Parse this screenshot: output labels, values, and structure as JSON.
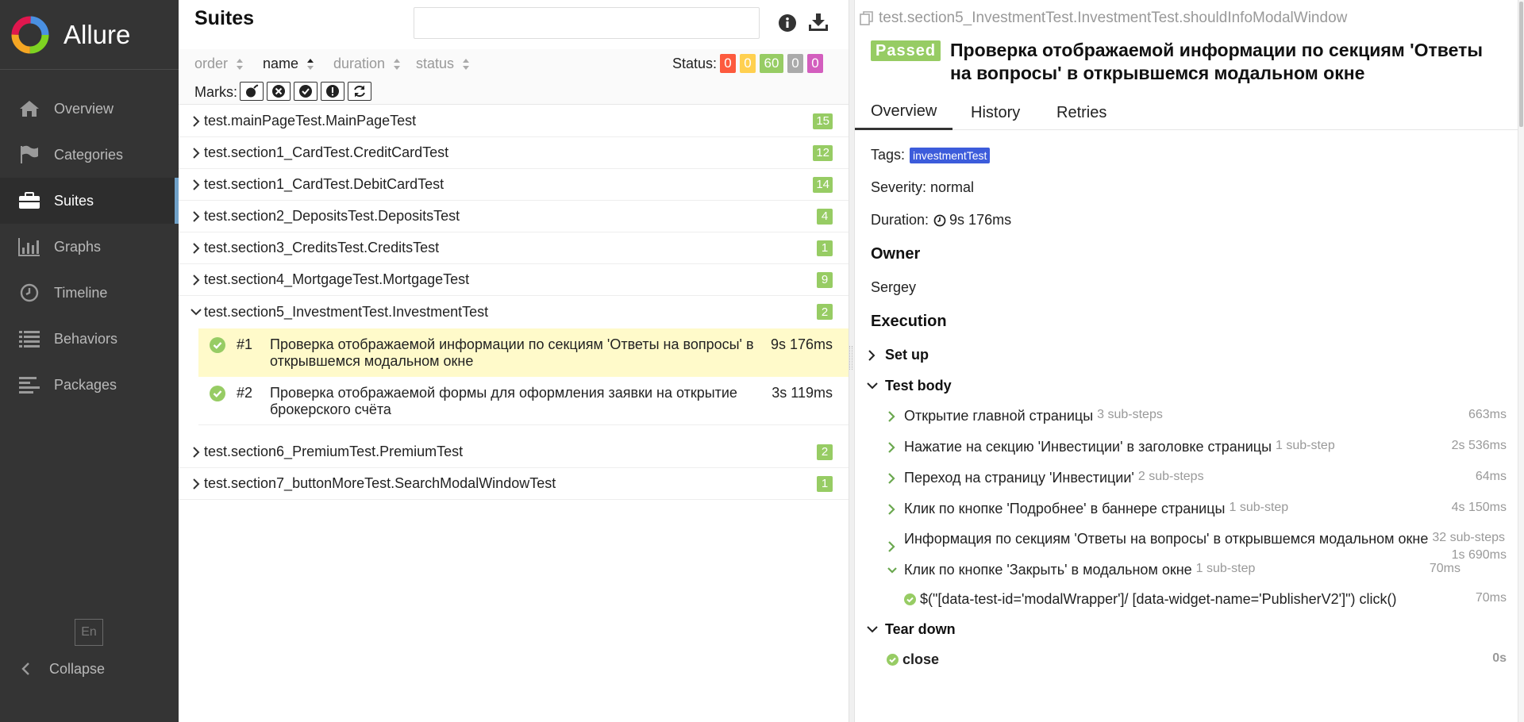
{
  "app": {
    "brand": "Allure"
  },
  "sidebar": {
    "items": [
      {
        "label": "Overview",
        "icon": "home-icon"
      },
      {
        "label": "Categories",
        "icon": "flag-icon"
      },
      {
        "label": "Suites",
        "icon": "briefcase-icon",
        "active": true
      },
      {
        "label": "Graphs",
        "icon": "bar-chart-icon"
      },
      {
        "label": "Timeline",
        "icon": "clock-icon"
      },
      {
        "label": "Behaviors",
        "icon": "list-icon"
      },
      {
        "label": "Packages",
        "icon": "align-left-icon"
      }
    ],
    "language": "En",
    "collapse": "Collapse"
  },
  "suites": {
    "title": "Suites",
    "search_placeholder": "",
    "sort": {
      "order": "order",
      "name": "name",
      "duration": "duration",
      "status": "status"
    },
    "status_label": "Status:",
    "counts": [
      {
        "value": "0",
        "color": "#fd5a3e"
      },
      {
        "value": "0",
        "color": "#ffd050"
      },
      {
        "value": "60",
        "color": "#97cc64"
      },
      {
        "value": "0",
        "color": "#aaaaaa"
      },
      {
        "value": "0",
        "color": "#d35ebe"
      }
    ],
    "marks_label": "Marks:",
    "rows": [
      {
        "name": "test.mainPageTest.MainPageTest",
        "count": "15"
      },
      {
        "name": "test.section1_CardTest.CreditCardTest",
        "count": "12"
      },
      {
        "name": "test.section1_CardTest.DebitCardTest",
        "count": "14"
      },
      {
        "name": "test.section2_DepositsTest.DepositsTest",
        "count": "4"
      },
      {
        "name": "test.section3_CreditsTest.CreditsTest",
        "count": "1"
      },
      {
        "name": "test.section4_MortgageTest.MortgageTest",
        "count": "9"
      },
      {
        "name": "test.section5_InvestmentTest.InvestmentTest",
        "count": "2"
      }
    ],
    "cases": [
      {
        "num": "#1",
        "title": "Проверка отображаемой информации по секциям 'Ответы на вопросы' в открывшемся модальном окне",
        "duration": "9s 176ms"
      },
      {
        "num": "#2",
        "title": "Проверка отображаемой формы для оформления заявки на открытие брокерского счёта",
        "duration": "3s 119ms"
      }
    ],
    "rows_after": [
      {
        "name": "test.section6_PremiumTest.PremiumTest",
        "count": "2"
      },
      {
        "name": "test.section7_buttonMoreTest.SearchModalWindowTest",
        "count": "1"
      }
    ]
  },
  "detail": {
    "breadcrumb": "test.section5_InvestmentTest.InvestmentTest.shouldInfoModalWindow",
    "status": "Passed",
    "title": "Проверка отображаемой информации по секциям 'Ответы на вопросы' в открывшемся модальном окне",
    "tabs": [
      "Overview",
      "History",
      "Retries"
    ],
    "tags_label": "Tags:",
    "tag": "investmentTest",
    "severity": "Severity: normal",
    "duration_label": "Duration:",
    "duration": "9s 176ms",
    "owner_heading": "Owner",
    "owner": "Sergey",
    "execution_heading": "Execution",
    "setup": "Set up",
    "test_body": "Test body",
    "steps": [
      {
        "name": "Открытие главной страницы",
        "sub": "3 sub-steps",
        "duration": "663ms"
      },
      {
        "name": "Нажатие на секцию 'Инвестиции' в заголовке страницы",
        "sub": "1 sub-step",
        "duration": "2s 536ms"
      },
      {
        "name": "Переход на страницу 'Инвестиции'",
        "sub": "2 sub-steps",
        "duration": "64ms"
      },
      {
        "name": "Клик по кнопке 'Подробнее' в баннере страницы",
        "sub": "1 sub-step",
        "duration": "4s 150ms"
      },
      {
        "name": "Информация по секциям 'Ответы на вопросы' в открывшемся модальном окне",
        "sub": "32 sub-steps",
        "duration": "1s 690ms"
      },
      {
        "name": "Клик по кнопке 'Закрыть' в модальном окне",
        "sub": "1 sub-step",
        "duration": "70ms"
      }
    ],
    "substep": {
      "name": "$(\"[data-test-id='modalWrapper']/ [data-widget-name='PublisherV2']\") click()",
      "duration": "70ms"
    },
    "teardown": "Tear down",
    "teardown_step": {
      "name": "close",
      "duration": "0s"
    }
  }
}
